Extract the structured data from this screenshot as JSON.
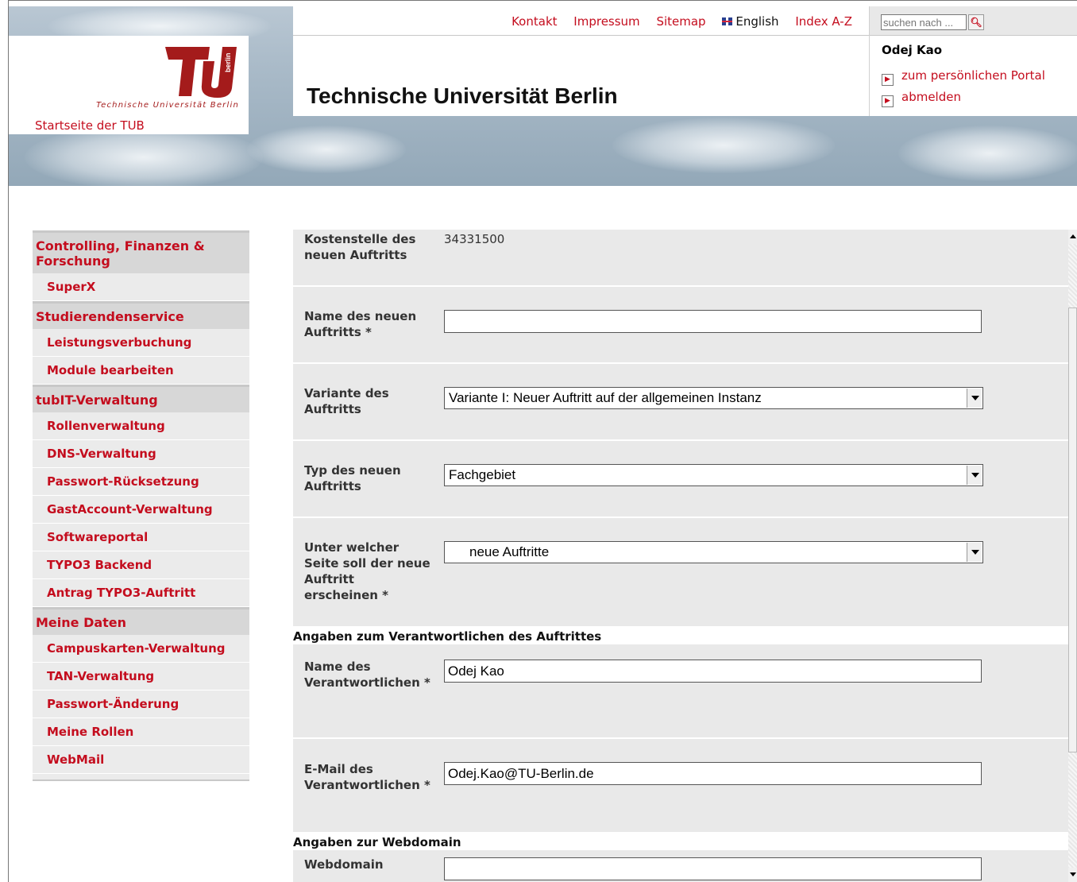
{
  "header": {
    "links": [
      "Kontakt",
      "Impressum",
      "Sitemap",
      "English",
      "Index A-Z"
    ],
    "title": "Technische Universität Berlin",
    "logo_text": "Technische Universität Berlin",
    "home_link": "Startseite der TUB",
    "search_placeholder": "suchen nach ...",
    "user_name": "Odej Kao",
    "portal_link": "zum persönlichen Portal",
    "logout_link": "abmelden",
    "brand_color": "#c40d1e"
  },
  "sidebar": {
    "groups": [
      {
        "title": "Controlling, Finanzen & Forschung",
        "items": [
          "SuperX"
        ]
      },
      {
        "title": "Studierendenservice",
        "items": [
          "Leistungsverbuchung",
          "Module bearbeiten"
        ]
      },
      {
        "title": "tubIT-Verwaltung",
        "items": [
          "Rollenverwaltung",
          "DNS-Verwaltung",
          "Passwort-Rücksetzung",
          "GastAccount-Verwaltung",
          "Softwareportal",
          "TYPO3 Backend",
          "Antrag TYPO3-Auftritt"
        ]
      },
      {
        "title": "Meine Daten",
        "items": [
          "Campuskarten-Verwaltung",
          "TAN-Verwaltung",
          "Passwort-Änderung",
          "Meine Rollen",
          "WebMail"
        ]
      }
    ]
  },
  "form": {
    "kostenstelle_label": "Kostenstelle des neuen Auftritts",
    "kostenstelle_value": "34331500",
    "name_label": "Name des neuen Auftritts *",
    "name_value": "",
    "variante_label": "Variante des Auftritts",
    "variante_value": "Variante I: Neuer Auftritt auf der allgemeinen Instanz",
    "typ_label": "Typ des neuen Auftritts",
    "typ_value": "Fachgebiet",
    "seite_label": "Unter welcher Seite soll der neue Auftritt erscheinen *",
    "seite_value": "neue Auftritte",
    "section_verantwortlich": "Angaben zum Verantwortlichen des Auftrittes",
    "verantw_name_label": "Name des Verantwortlichen *",
    "verantw_name_value": "Odej Kao",
    "verantw_email_label": "E-Mail des Verantwortlichen *",
    "verantw_email_value": "Odej.Kao@TU-Berlin.de",
    "section_webdomain": "Angaben zur Webdomain",
    "webdomain_label": "Webdomain",
    "webdomain_value": ""
  }
}
